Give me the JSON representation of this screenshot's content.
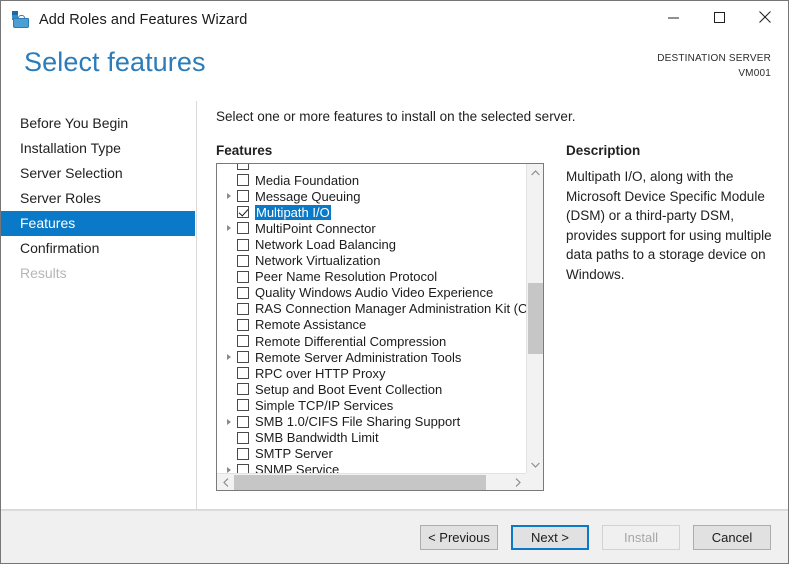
{
  "window": {
    "title": "Add Roles and Features Wizard",
    "icon": "wizard-toolbox-icon",
    "controls": {
      "minimize": "Minimize",
      "maximize": "Maximize",
      "close": "Close"
    }
  },
  "header": {
    "page_title": "Select features",
    "destination_label": "DESTINATION SERVER",
    "destination_value": "VM001",
    "accent_color": "#2b7cb9"
  },
  "sidebar": {
    "selected_index": 4,
    "highlight_color": "#0a7ac8",
    "items": [
      {
        "label": "Before You Begin",
        "state": "normal"
      },
      {
        "label": "Installation Type",
        "state": "normal"
      },
      {
        "label": "Server Selection",
        "state": "normal"
      },
      {
        "label": "Server Roles",
        "state": "normal"
      },
      {
        "label": "Features",
        "state": "selected"
      },
      {
        "label": "Confirmation",
        "state": "normal"
      },
      {
        "label": "Results",
        "state": "disabled"
      }
    ]
  },
  "main": {
    "instruction": "Select one or more features to install on the selected server.",
    "features_label": "Features",
    "features": [
      {
        "label": "",
        "checked": false,
        "expandable": false,
        "selected": false,
        "partial": true
      },
      {
        "label": "Media Foundation",
        "checked": false,
        "expandable": false,
        "selected": false
      },
      {
        "label": "Message Queuing",
        "checked": false,
        "expandable": true,
        "selected": false
      },
      {
        "label": "Multipath I/O",
        "checked": true,
        "expandable": false,
        "selected": true
      },
      {
        "label": "MultiPoint Connector",
        "checked": false,
        "expandable": true,
        "selected": false
      },
      {
        "label": "Network Load Balancing",
        "checked": false,
        "expandable": false,
        "selected": false
      },
      {
        "label": "Network Virtualization",
        "checked": false,
        "expandable": false,
        "selected": false
      },
      {
        "label": "Peer Name Resolution Protocol",
        "checked": false,
        "expandable": false,
        "selected": false
      },
      {
        "label": "Quality Windows Audio Video Experience",
        "checked": false,
        "expandable": false,
        "selected": false
      },
      {
        "label": "RAS Connection Manager Administration Kit (CMAK)",
        "checked": false,
        "expandable": false,
        "selected": false
      },
      {
        "label": "Remote Assistance",
        "checked": false,
        "expandable": false,
        "selected": false
      },
      {
        "label": "Remote Differential Compression",
        "checked": false,
        "expandable": false,
        "selected": false
      },
      {
        "label": "Remote Server Administration Tools",
        "checked": false,
        "expandable": true,
        "selected": false
      },
      {
        "label": "RPC over HTTP Proxy",
        "checked": false,
        "expandable": false,
        "selected": false
      },
      {
        "label": "Setup and Boot Event Collection",
        "checked": false,
        "expandable": false,
        "selected": false
      },
      {
        "label": "Simple TCP/IP Services",
        "checked": false,
        "expandable": false,
        "selected": false
      },
      {
        "label": "SMB 1.0/CIFS File Sharing Support",
        "checked": false,
        "expandable": true,
        "selected": false
      },
      {
        "label": "SMB Bandwidth Limit",
        "checked": false,
        "expandable": false,
        "selected": false
      },
      {
        "label": "SMTP Server",
        "checked": false,
        "expandable": false,
        "selected": false
      },
      {
        "label": "SNMP Service",
        "checked": false,
        "expandable": true,
        "selected": false
      }
    ],
    "scrollbars": {
      "vertical": {
        "thumb_top_pct": 33,
        "thumb_height_pct": 23
      },
      "horizontal": {
        "thumb_left_pct": 0,
        "thumb_width_pct": 84
      }
    }
  },
  "description": {
    "title": "Description",
    "text": "Multipath I/O, along with the Microsoft Device Specific Module (DSM) or a third-party DSM, provides support for using multiple data paths to a storage device on Windows."
  },
  "footer": {
    "previous": "< Previous",
    "next": "Next >",
    "install": "Install",
    "cancel": "Cancel",
    "install_enabled": false,
    "default_button": "Next >"
  }
}
